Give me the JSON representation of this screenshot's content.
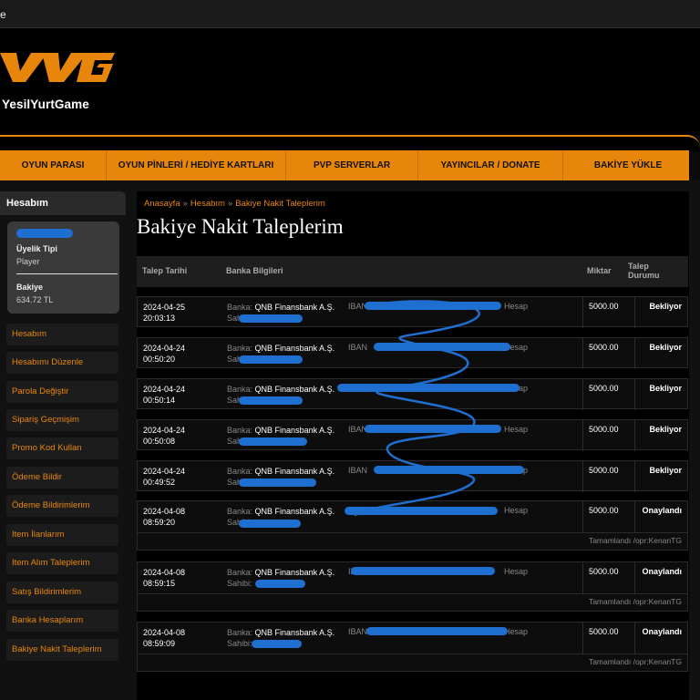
{
  "window": {
    "tab_text": "e"
  },
  "brand": {
    "name": "YesilYurtGame"
  },
  "nav": [
    {
      "label": "OYUN PARASI"
    },
    {
      "label": "OYUN PİNLERİ / HEDİYE KARTLARI"
    },
    {
      "label": "PVP SERVERLAR"
    },
    {
      "label": "YAYINCILAR / DONATE"
    },
    {
      "label": "BAKİYE YÜKLE"
    }
  ],
  "sidebar": {
    "title": "Hesabım",
    "account": {
      "membership_label": "Üyelik Tipi",
      "membership_value": "Player",
      "balance_label": "Bakiye",
      "balance_value": "634.72 TL"
    },
    "items": [
      {
        "label": "Hesabım"
      },
      {
        "label": "Hesabımı Düzenle"
      },
      {
        "label": "Parola Değiştir"
      },
      {
        "label": "Sipariş Geçmişim"
      },
      {
        "label": "Promo Kod Kullan"
      },
      {
        "label": "Ödeme Bildir"
      },
      {
        "label": "Ödeme Bildirimlerim"
      },
      {
        "label": "Item İlanlarım"
      },
      {
        "label": "Item Alım Taleplerim"
      },
      {
        "label": "Satış Bildirimlerim"
      },
      {
        "label": "Banka Hesaplarım"
      },
      {
        "label": "Bakiye Nakit Taleplerim"
      }
    ]
  },
  "breadcrumb": [
    "Anasayfa",
    "Hesabım",
    "Bakiye Nakit Taleplerim"
  ],
  "breadcrumb_separator": "»",
  "page_title": "Bakiye Nakit Taleplerim",
  "table": {
    "headers": {
      "date": "Talep Tarihi",
      "bank": "Banka Bilgileri",
      "amount": "Miktar",
      "status_line1": "Talep",
      "status_line2": "Durumu"
    },
    "labels": {
      "bank": "Banka:",
      "owner": "Sahibi:",
      "iban": "IBAN",
      "hesap": "Hesap"
    },
    "rows": [
      {
        "date": "2024-04-25",
        "time": "20:03:13",
        "bank": "QNB Finansbank A.Ş.",
        "amount": "5000.00",
        "status": "Bekliyor",
        "note": ""
      },
      {
        "date": "2024-04-24",
        "time": "00:50:20",
        "bank": "QNB Finansbank A.Ş.",
        "amount": "5000.00",
        "status": "Bekliyor",
        "note": ""
      },
      {
        "date": "2024-04-24",
        "time": "00:50:14",
        "bank": "QNB Finansbank A.Ş.",
        "amount": "5000.00",
        "status": "Bekliyor",
        "note": ""
      },
      {
        "date": "2024-04-24",
        "time": "00:50:08",
        "bank": "QNB Finansbank A.Ş.",
        "amount": "5000.00",
        "status": "Bekliyor",
        "note": ""
      },
      {
        "date": "2024-04-24",
        "time": "00:49:52",
        "bank": "QNB Finansbank A.Ş.",
        "amount": "5000.00",
        "status": "Bekliyor",
        "note": ""
      },
      {
        "date": "2024-04-08",
        "time": "08:59:20",
        "bank": "QNB Finansbank A.Ş.",
        "amount": "5000.00",
        "status": "Onaylandı",
        "note": "Tamamlandı /opr:KenanTG"
      },
      {
        "date": "2024-04-08",
        "time": "08:59:15",
        "bank": "QNB Finansbank A.Ş.",
        "amount": "5000.00",
        "status": "Onaylandı",
        "note": "Tamamlandı /opr:KenanTG"
      },
      {
        "date": "2024-04-08",
        "time": "08:59:09",
        "bank": "QNB Finansbank A.Ş.",
        "amount": "5000.00",
        "status": "Onaylandı",
        "note": "Tamamlandı /opr:KenanTG"
      }
    ]
  },
  "colors": {
    "accent": "#e8860c",
    "redaction": "#1e6fd0"
  }
}
